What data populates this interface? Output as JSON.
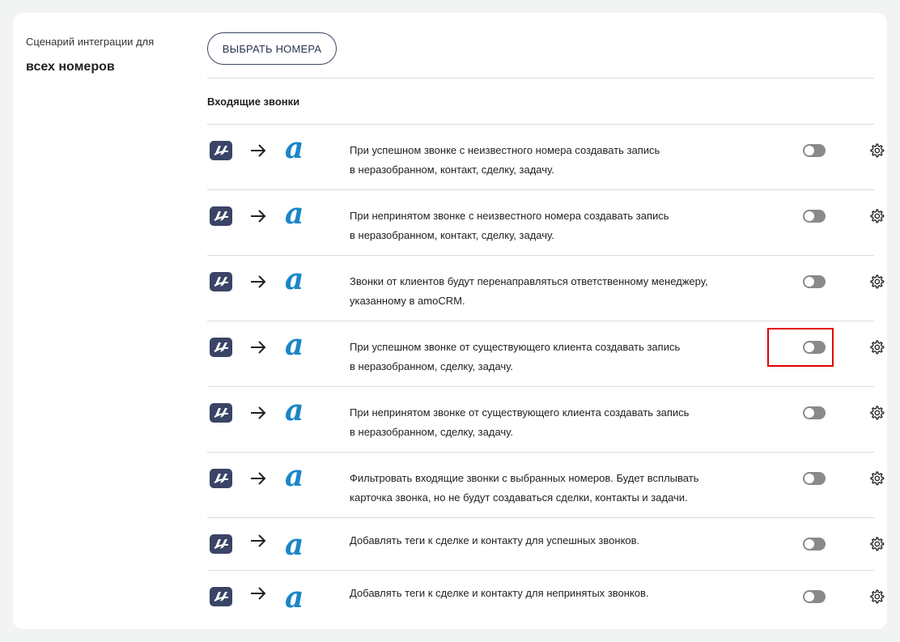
{
  "sidebar": {
    "caption": "Сценарий интеграции для",
    "title": "всех номеров"
  },
  "header": {
    "select_button_label": "ВЫБРАТЬ НОМЕРА"
  },
  "section": {
    "title": "Входящие звонки"
  },
  "colors": {
    "source_icon": "#3a4466",
    "amo_icon": "#1a86c8",
    "toggle_off": "#8a8a8a",
    "highlight": "#e00000"
  },
  "icons": {
    "source": "telephony-logo-icon",
    "arrow": "arrow-right-icon",
    "target": "amocrm-logo-icon",
    "settings": "gear-icon"
  },
  "amo_glyph": "a",
  "rules": [
    {
      "line1": "При успешном звонке с неизвестного номера создавать запись",
      "line2": "в неразобранном, контакт, сделку, задачу.",
      "enabled": false
    },
    {
      "line1": "При непринятом звонке с неизвестного номера создавать запись",
      "line2": "в неразобранном, контакт, сделку, задачу.",
      "enabled": false
    },
    {
      "line1": "Звонки от клиентов будут перенаправляться ответственному менеджеру,",
      "line2": "указанному в amoCRM.",
      "enabled": false
    },
    {
      "line1": "При успешном звонке от существующего клиента создавать запись",
      "line2": "в неразобранном, сделку, задачу.",
      "enabled": false
    },
    {
      "line1": "При непринятом звонке от существующего клиента создавать запись",
      "line2": "в неразобранном, сделку, задачу.",
      "enabled": false
    },
    {
      "line1": "Фильтровать входящие звонки с выбранных номеров. Будет всплывать",
      "line2": "карточка звонка, но не будут создаваться сделки, контакты и задачи.",
      "enabled": false
    },
    {
      "line1": "Добавлять теги к сделке и контакту для успешных звонков.",
      "line2": "",
      "enabled": false
    },
    {
      "line1": "Добавлять теги к сделке и контакту для непринятых звонков.",
      "line2": "",
      "enabled": false
    }
  ]
}
